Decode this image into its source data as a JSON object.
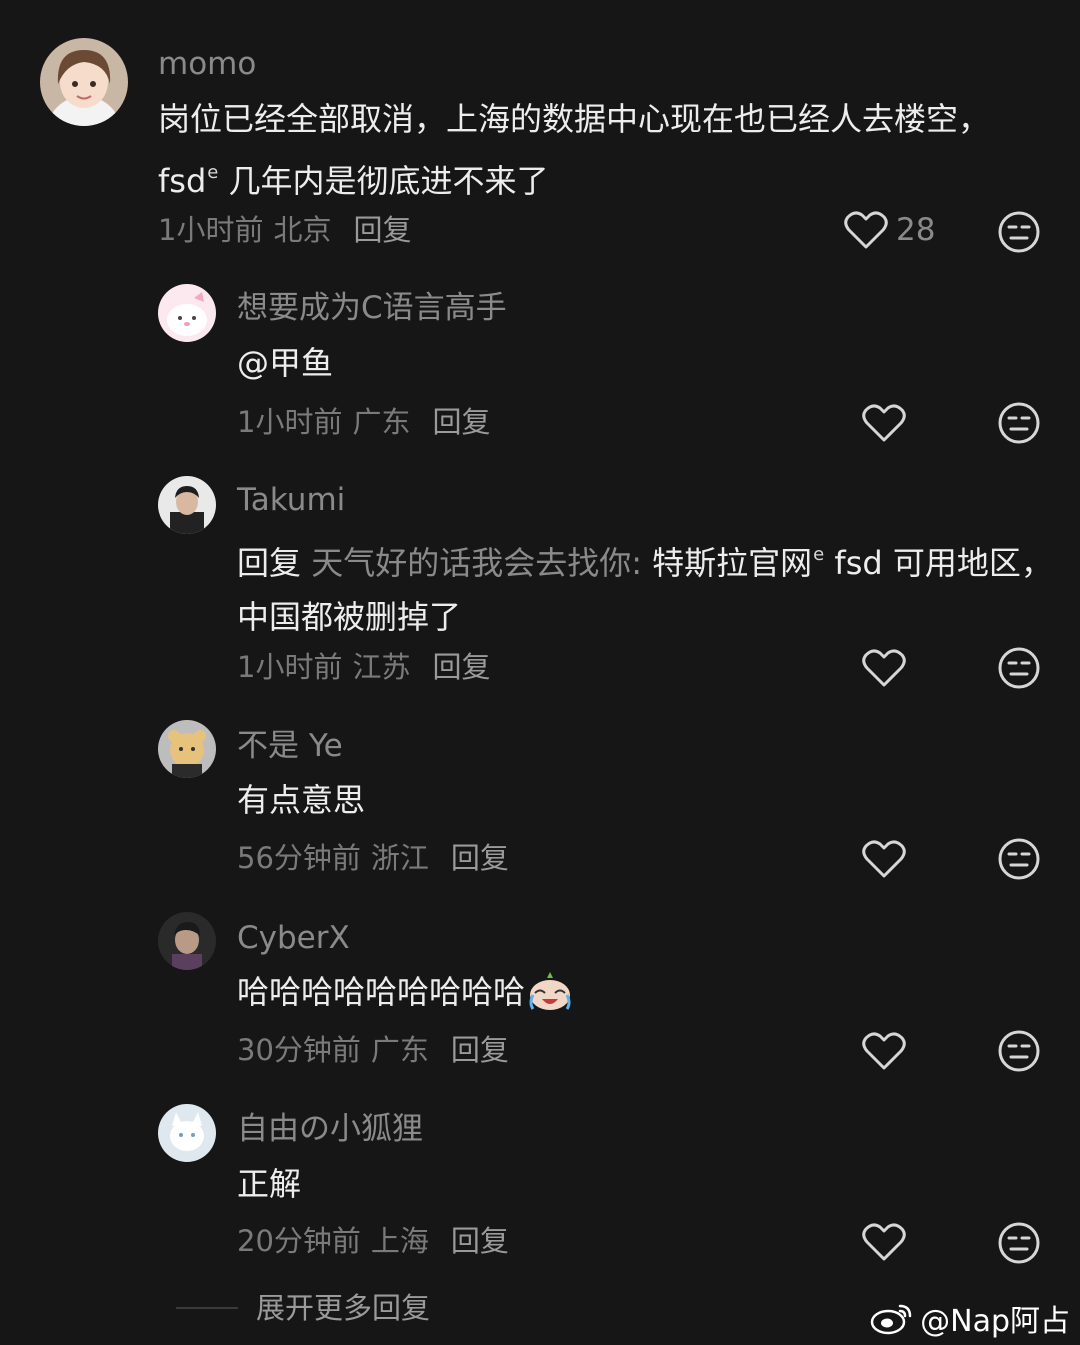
{
  "comments": [
    {
      "username": "momo",
      "text_main": "岗位已经全部取消，上海的数据中心现在也已经人去楼空， fsd",
      "text_tail": "几年内是彻底进不来了",
      "time": "1小时前",
      "location": "北京",
      "reply_label": "回复",
      "like_count": "28"
    },
    {
      "username": "想要成为C语言高手",
      "text": "@甲鱼",
      "time": "1小时前",
      "location": "广东",
      "reply_label": "回复"
    },
    {
      "username": "Takumi",
      "reply_prefix": "回复",
      "reply_to": "天气好的话我会去找你:",
      "text_main": "特斯拉官网",
      "text_tail": "fsd 可用地区，中国都被删掉了",
      "time": "1小时前",
      "location": "江苏",
      "reply_label": "回复"
    },
    {
      "username": "不是 Ye",
      "text": "有点意思",
      "time": "56分钟前",
      "location": "浙江",
      "reply_label": "回复"
    },
    {
      "username": "CyberX",
      "text": "哈哈哈哈哈哈哈哈哈",
      "time": "30分钟前",
      "location": "广东",
      "reply_label": "回复"
    },
    {
      "username": "自由の小狐狸",
      "text": "正解",
      "time": "20分钟前",
      "location": "上海",
      "reply_label": "回复"
    }
  ],
  "expand_label": "展开更多回复",
  "watermark": "@Nap阿占",
  "icons": {
    "like": "heart-outline-icon",
    "dislike": "neutral-face-icon",
    "search_hint": "search-hint-icon",
    "crying_laughing_emoji": "laughing-crying-emoji-icon",
    "weibo_logo": "weibo-logo-icon"
  },
  "colors": {
    "background": "#161616",
    "primary_text": "#ededed",
    "secondary_text": "#8a8a8a",
    "icon": "#d6d6d6"
  }
}
